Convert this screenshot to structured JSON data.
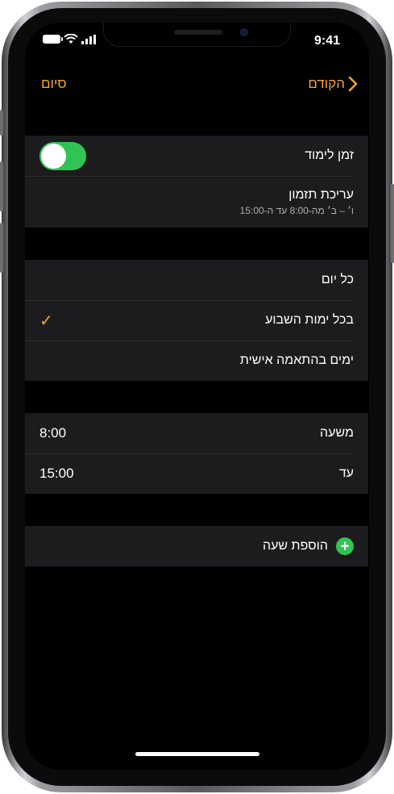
{
  "status": {
    "time": "9:41"
  },
  "nav": {
    "done": "סיום",
    "back": "הקודם"
  },
  "schooltime": {
    "toggle_label": "זמן לימוד",
    "toggle_on": true,
    "edit_label": "עריכת תזמון",
    "edit_subtitle": "ו׳ – ב׳ מה-8:00 עד ה-15:00"
  },
  "days": {
    "options": [
      "כל יום",
      "בכל ימות השבוע",
      "ימים בהתאמה אישית"
    ],
    "selected": "בכל ימות השבוע"
  },
  "hours": {
    "from_label": "משעה",
    "from_value": "8:00",
    "to_label": "עד",
    "to_value": "15:00"
  },
  "add": {
    "label": "הוספת שעה"
  },
  "colors": {
    "accent": "#f5a623",
    "toggle": "#30c455",
    "group_bg": "#1c1c1e"
  }
}
